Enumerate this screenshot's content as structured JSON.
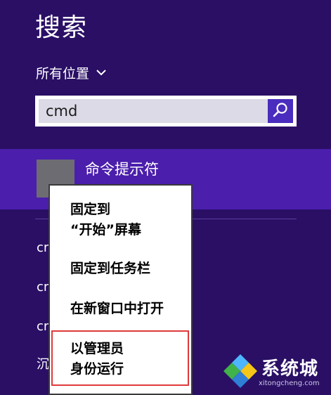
{
  "search_pane": {
    "title": "搜索",
    "scope_label": "所有位置",
    "query": "cmd"
  },
  "results": {
    "top_result_label": "命令提示符",
    "peek_items": [
      "cr",
      "cr",
      "cr",
      "沉"
    ]
  },
  "context_menu": {
    "items": [
      {
        "label": "固定到\n“开始”屏幕"
      },
      {
        "label": "固定到任务栏"
      },
      {
        "label": "在新窗口中打开"
      },
      {
        "label": "以管理员\n身份运行",
        "highlighted": true
      }
    ]
  },
  "watermark": {
    "brand": "系统城",
    "domain": "xitongcheng.com"
  },
  "colors": {
    "background": "#2a0f65",
    "selected_result": "#4b1eac",
    "search_button": "#4a2cbe",
    "highlight_border": "#e03a3a"
  }
}
